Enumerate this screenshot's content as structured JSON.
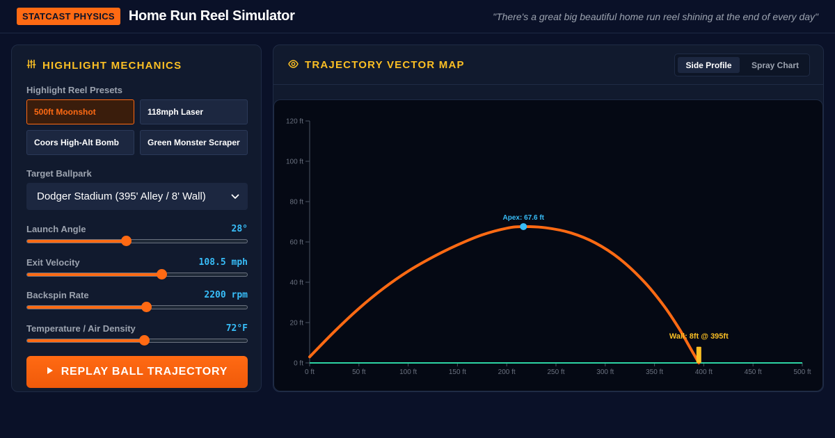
{
  "header": {
    "badge": "STATCAST PHYSICS",
    "title": "Home Run Reel Simulator",
    "quote": "\"There's a great big beautiful home run reel shining at the end of every day\""
  },
  "controls": {
    "title": "HIGHLIGHT MECHANICS",
    "presets_label": "Highlight Reel Presets",
    "presets": [
      {
        "label": "500ft Moonshot",
        "active": true
      },
      {
        "label": "118mph Laser",
        "active": false
      },
      {
        "label": "Coors High-Alt Bomb",
        "active": false
      },
      {
        "label": "Green Monster Scraper",
        "active": false
      }
    ],
    "ballpark_label": "Target Ballpark",
    "ballpark_value": "Dodger Stadium (395' Alley / 8' Wall)",
    "sliders": [
      {
        "label": "Launch Angle",
        "value": "28°",
        "fraction": 0.45
      },
      {
        "label": "Exit Velocity",
        "value": "108.5 mph",
        "fraction": 0.61
      },
      {
        "label": "Backspin Rate",
        "value": "2200 rpm",
        "fraction": 0.54
      },
      {
        "label": "Temperature / Air Density",
        "value": "72°F",
        "fraction": 0.53
      }
    ],
    "replay_label": "REPLAY BALL TRAJECTORY"
  },
  "viz": {
    "title": "TRAJECTORY VECTOR MAP",
    "tabs": [
      {
        "label": "Side Profile",
        "active": true
      },
      {
        "label": "Spray Chart",
        "active": false
      }
    ]
  },
  "colors": {
    "accent": "#ff6a13",
    "title": "#fbbf24",
    "value": "#38bdf8",
    "ground": "#2dd4a4",
    "apex": "#38bdf8"
  },
  "chart_data": {
    "type": "line",
    "xlim": [
      0,
      500
    ],
    "ylim": [
      0,
      120
    ],
    "x_ticks": [
      0,
      50,
      100,
      150,
      200,
      250,
      300,
      350,
      400,
      450,
      500
    ],
    "y_ticks": [
      0,
      20,
      40,
      60,
      80,
      100,
      120
    ],
    "x_tick_labels": [
      "0 ft",
      "50 ft",
      "100 ft",
      "150 ft",
      "200 ft",
      "250 ft",
      "300 ft",
      "350 ft",
      "400 ft",
      "450 ft",
      "500 ft"
    ],
    "y_tick_labels": [
      "0 ft",
      "20 ft",
      "40 ft",
      "60 ft",
      "80 ft",
      "100 ft",
      "120 ft"
    ],
    "series": [
      {
        "x": [
          0,
          25,
          50,
          75,
          100,
          125,
          150,
          175,
          200,
          217,
          240,
          265,
          290,
          315,
          340,
          360,
          375,
          385,
          395
        ],
        "y": [
          3,
          15.5,
          27,
          37,
          45.5,
          52.5,
          58.5,
          63.5,
          66.8,
          67.6,
          67,
          64.5,
          59.5,
          51.5,
          40,
          28,
          17,
          8.5,
          0
        ]
      }
    ],
    "annotations": [
      {
        "x": 217,
        "y": 67.6,
        "text": "Apex: 67.6 ft"
      },
      {
        "x": 395,
        "y": 8,
        "text": "Wall: 8ft @ 395ft"
      }
    ],
    "wall": {
      "x": 395,
      "height": 8
    }
  }
}
